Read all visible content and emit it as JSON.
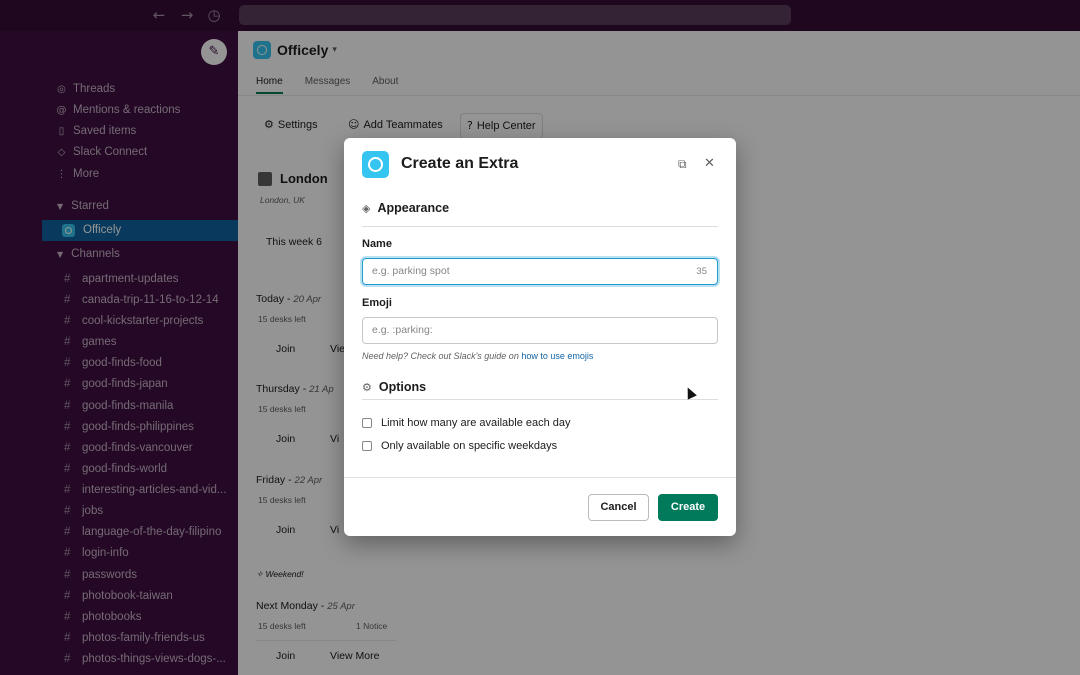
{
  "topbar": {
    "back_icon": "arrow-left-icon",
    "forward_icon": "arrow-right-icon",
    "history_icon": "clock-icon"
  },
  "sidebar": {
    "nav": [
      {
        "label": "Threads",
        "icon": "threads-icon"
      },
      {
        "label": "Mentions & reactions",
        "icon": "at-icon"
      },
      {
        "label": "Saved items",
        "icon": "bookmark-icon"
      },
      {
        "label": "Slack Connect",
        "icon": "connect-icon"
      },
      {
        "label": "More",
        "icon": "kebab-icon"
      }
    ],
    "starred_heading": "Starred",
    "starred_item": "Officely",
    "channels_heading": "Channels",
    "channels": [
      "apartment-updates",
      "canada-trip-11-16-to-12-14",
      "cool-kickstarter-projects",
      "games",
      "good-finds-food",
      "good-finds-japan",
      "good-finds-manila",
      "good-finds-philippines",
      "good-finds-vancouver",
      "good-finds-world",
      "interesting-articles-and-vid...",
      "jobs",
      "language-of-the-day-filipino",
      "login-info",
      "passwords",
      "photobook-taiwan",
      "photobooks",
      "photos-family-friends-us",
      "photos-things-views-dogs-..."
    ]
  },
  "main": {
    "app_name": "Officely",
    "tabs": [
      "Home",
      "Messages",
      "About"
    ],
    "tools": {
      "settings": "Settings",
      "add": "Add Teammates",
      "help": "Help Center"
    },
    "location_title": "London",
    "location_sub": "London, UK",
    "week_line": "This week 6",
    "days": [
      {
        "name": "Today",
        "date": "20 Apr",
        "desks": "15 desks left",
        "join": "Join",
        "view": "View"
      },
      {
        "name": "Thursday",
        "date": "21 Ap",
        "desks": "15 desks left",
        "join": "Join",
        "view": "Vi"
      },
      {
        "name": "Friday",
        "date": "22 Apr",
        "desks": "15 desks left",
        "join": "Join",
        "view": "Vi"
      }
    ],
    "weekend": "Weekend!",
    "next": {
      "name": "Next Monday",
      "date": "25 Apr",
      "desks": "15 desks left",
      "notice": "1 Notice",
      "join": "Join",
      "view": "View More"
    }
  },
  "modal": {
    "title": "Create an Extra",
    "appearance_heading": "Appearance",
    "name_label": "Name",
    "name_placeholder": "e.g. parking spot",
    "name_count": "35",
    "emoji_label": "Emoji",
    "emoji_placeholder": "e.g. :parking:",
    "help_prefix": "Need help? Check out Slack's guide on ",
    "help_link": "how to use emojis",
    "options_heading": "Options",
    "option_1": "Limit how many are available each day",
    "option_2": "Only available on specific weekdays",
    "cancel": "Cancel",
    "create": "Create"
  },
  "colors": {
    "sidebar_bg": "#3f0e40",
    "selected_bg": "#1164a3",
    "accent_green": "#007a5a",
    "logo_blue": "#36c5f0",
    "link_blue": "#1264a3"
  }
}
